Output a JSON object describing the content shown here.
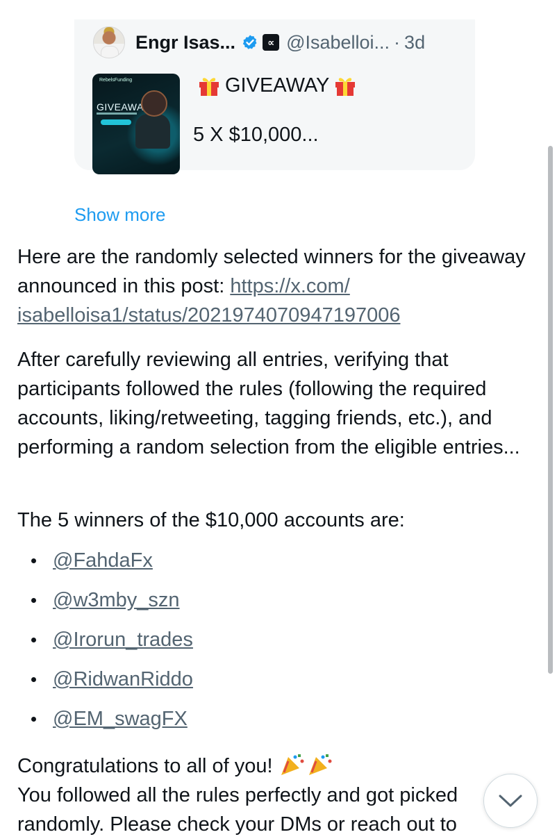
{
  "quote": {
    "author_name": "Engr Isas...",
    "handle": "@Isabelloi...",
    "separator": "·",
    "time": "3d",
    "affiliate_badge": "∝",
    "line1": "GIVEAWAY",
    "line2": "5 X $10,000...",
    "thumbnail": {
      "brand": "RebelsFunding",
      "title": "GIVEAWAY"
    }
  },
  "show_more": "Show more",
  "post": {
    "p1_text": "Here are the randomly selected winners for the giveaway announced in this post: ",
    "p1_link": "https://x.com/isabelloisa1/status/2021974070947197006",
    "p1_link_display_a": "https://x.com/",
    "p1_link_display_b": "isabelloisa1/status/2021974070947197006",
    "p2": "After carefully reviewing all entries, verifying that participants followed the rules (following the required accounts, liking/retweeting, tagging friends, etc.), and performing a random selection from the eligible entries...",
    "p3": "The 5 winners of the $10,000 accounts are:",
    "winners": [
      "@FahdaFx",
      "@w3mby_szn",
      "@Irorun_trades",
      "@RidwanRiddo",
      "@EM_swagFX"
    ],
    "p4_line1": "Congratulations to all of you! ",
    "p4_line2": "You followed all the rules perfectly and got picked randomly. Please check your DMs or reach out to"
  },
  "icons": {
    "verified": "verified-badge-icon",
    "gift": "gift-icon",
    "party": "party-popper-icon",
    "scroll": "chevron-down-icon"
  },
  "colors": {
    "link_blue": "#1d9bf0",
    "verified_blue": "#1d9bf0",
    "text": "#0f1419",
    "muted": "#536471",
    "card_bg": "#f5f7f8"
  }
}
